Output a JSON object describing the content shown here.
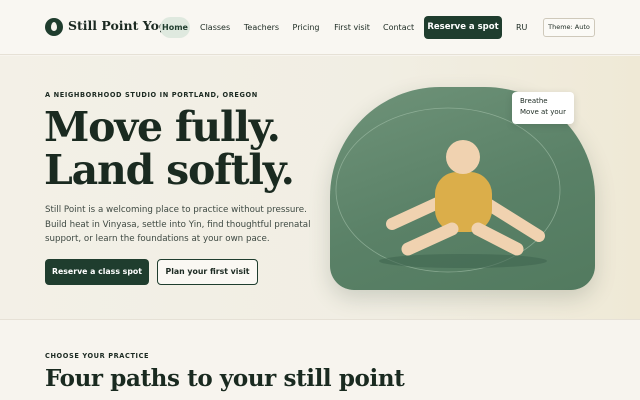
{
  "brand": {
    "name": "Still Point Yoga",
    "logo_icon": "leaf-icon"
  },
  "nav": {
    "items": [
      "Home",
      "Classes",
      "Teachers",
      "Pricing",
      "First visit",
      "Contact"
    ],
    "active": "Home",
    "cta": "Reserve a spot",
    "language": "RU",
    "theme": "Theme: Auto"
  },
  "hero": {
    "eyebrow": "A NEIGHBORHOOD STUDIO IN PORTLAND, OREGON",
    "headline_line1": "Move fully.",
    "headline_line2": "Land softly.",
    "lede": "Still Point is a welcoming place to practice without pressure. Build heat in Vinyasa, settle into Yin, find thoughtful prenatal support, or learn the foundations at your own pace.",
    "primary_button": "Reserve a class spot",
    "secondary_button": "Plan your first visit",
    "bubble_line1": "Breathe",
    "bubble_line2": "Move at your"
  },
  "practices": {
    "eyebrow": "CHOOSE YOUR PRACTICE",
    "title": "Four paths to your still point"
  },
  "colors": {
    "brand_green": "#1f3d2e",
    "art_green": "#5a8167",
    "figure_skin": "#f0d2b0",
    "figure_shirt": "#dbae4a",
    "page_bg": "#f7f4ee"
  }
}
